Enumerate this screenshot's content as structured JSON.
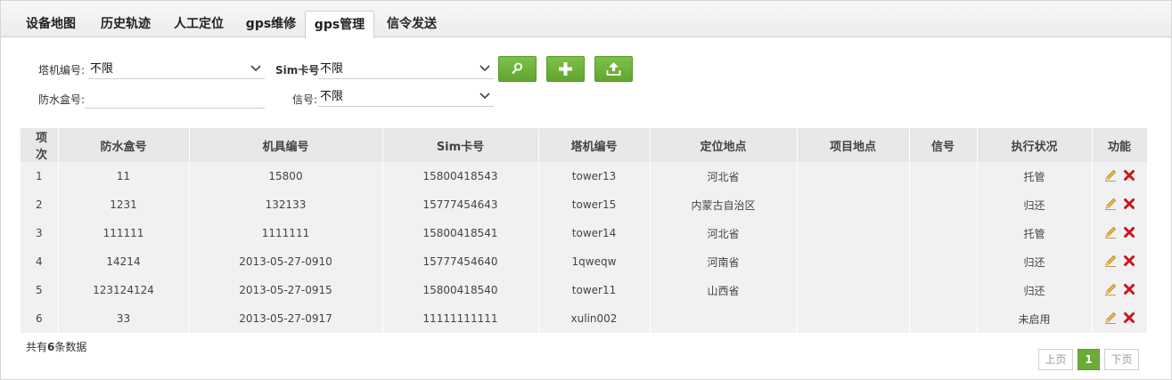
{
  "tabs": [
    {
      "label": "设备地图",
      "active": false
    },
    {
      "label": "历史轨迹",
      "active": false
    },
    {
      "label": "人工定位",
      "active": false
    },
    {
      "label": "gps维修",
      "active": false
    },
    {
      "label": "gps管理",
      "active": true
    },
    {
      "label": "信令发送",
      "active": false
    }
  ],
  "filters": {
    "tower_label": "塔机编号:",
    "tower_value": "不限",
    "sim_label": "Sim卡号",
    "sim_value": "不限",
    "box_label": "防水盒号:",
    "box_value": "",
    "signal_label": "信号:",
    "signal_value": "不限"
  },
  "actions": {
    "search_icon": "search-icon",
    "add_icon": "plus-icon",
    "upload_icon": "upload-icon",
    "accent": "#6aac37"
  },
  "table": {
    "headers": [
      "项次",
      "防水盒号",
      "机具编号",
      "Sim卡号",
      "塔机编号",
      "定位地点",
      "项目地点",
      "信号",
      "执行状况",
      "功能"
    ],
    "rows": [
      [
        "1",
        "11",
        "15800",
        "15800418543",
        "tower13",
        "河北省",
        "",
        "",
        "托管"
      ],
      [
        "2",
        "1231",
        "132133",
        "15777454643",
        "tower15",
        "内蒙古自治区",
        "",
        "",
        "归还"
      ],
      [
        "3",
        "111111",
        "1111111",
        "15800418541",
        "tower14",
        "河北省",
        "",
        "",
        "托管"
      ],
      [
        "4",
        "14214",
        "2013-05-27-0910",
        "15777454640",
        "1qweqw",
        "河南省",
        "",
        "",
        "归还"
      ],
      [
        "5",
        "123124124",
        "2013-05-27-0915",
        "15800418540",
        "tower11",
        "山西省",
        "",
        "",
        "归还"
      ],
      [
        "6",
        "33",
        "2013-05-27-0917",
        "11111111111",
        "xulin002",
        "",
        "",
        "",
        "未启用"
      ]
    ]
  },
  "footer": {
    "total_prefix": "共有",
    "total_count": "6",
    "total_suffix": "条数据"
  },
  "pagination": {
    "prev": "上页",
    "current": "1",
    "next": "下页"
  }
}
